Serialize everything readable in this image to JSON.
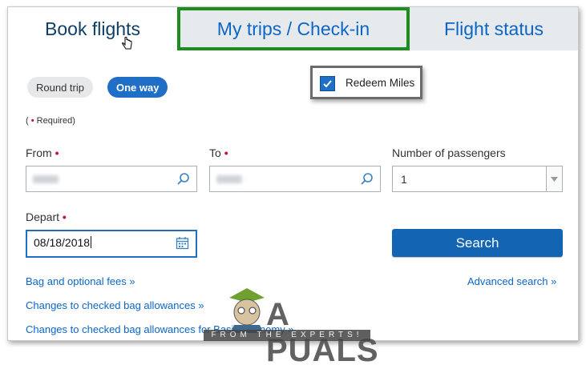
{
  "tabs": {
    "book": "Book flights",
    "trips": "My trips / Check-in",
    "status": "Flight status"
  },
  "trip_type": {
    "round": "Round trip",
    "oneway": "One way"
  },
  "redeem_miles": {
    "label": "Redeem Miles",
    "checked": true
  },
  "required_note": {
    "open": "(",
    "dot": "•",
    "text": " Required)"
  },
  "form": {
    "from_label": "From",
    "to_label": "To",
    "passengers_label": "Number of passengers",
    "passengers_value": "1",
    "depart_label": "Depart",
    "depart_value": "08/18/2018",
    "required_marker": "•"
  },
  "search_label": "Search",
  "links": {
    "bag_fees": "Bag and optional fees »",
    "advanced": "Advanced search »",
    "checked_bag": "Changes to checked bag allowances »",
    "checked_bag_basic": "Changes to checked bag allowances for Basic Economy »"
  },
  "watermark": {
    "text": "A  PUALS",
    "sub": "FROM THE EXPERTS!"
  },
  "colors": {
    "accent": "#1f6fc6",
    "highlight": "#1e8c1e",
    "required": "#c8102e"
  }
}
